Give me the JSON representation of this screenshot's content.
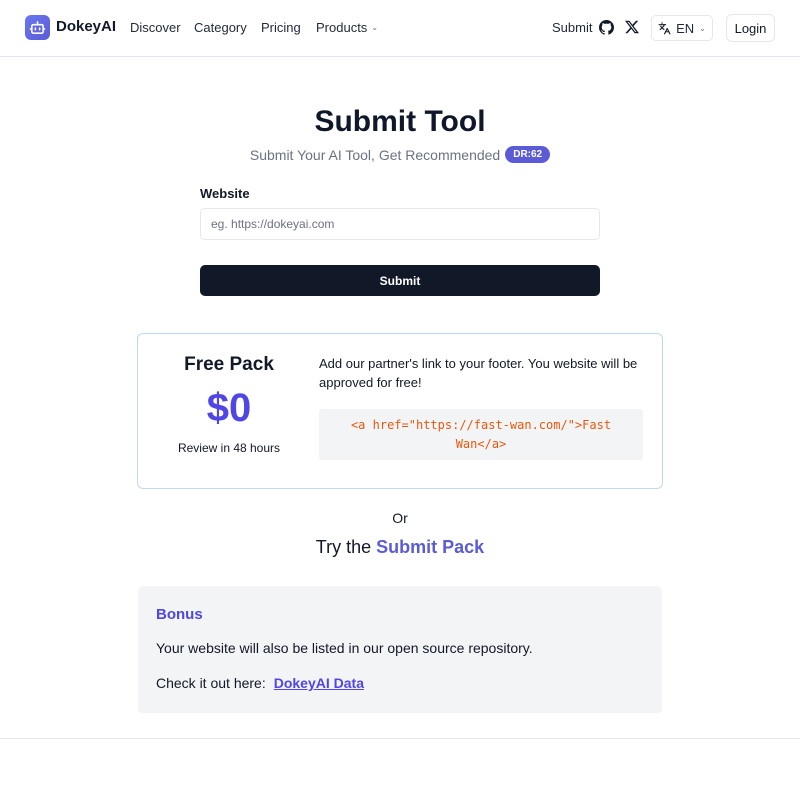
{
  "header": {
    "brand": "DokeyAI",
    "nav": {
      "discover": "Discover",
      "category": "Category",
      "pricing": "Pricing",
      "products": "Products"
    },
    "submit_label": "Submit",
    "language": "EN",
    "login_label": "Login",
    "icons": [
      "robot-logo-icon",
      "github-icon",
      "x-twitter-icon",
      "translate-icon",
      "chevron-down-icon"
    ]
  },
  "main": {
    "title": "Submit Tool",
    "subtitle": "Submit Your AI Tool, Get Recommended",
    "dr_badge": "DR:62",
    "form": {
      "website_label": "Website",
      "website_placeholder": "eg. https://dokeyai.com",
      "website_value": "",
      "submit_label": "Submit"
    },
    "free_pack": {
      "name": "Free Pack",
      "price": "$0",
      "review": "Review in 48 hours",
      "description": "Add our partner's link to your footer. You website will be approved for free!",
      "code_snippet": "<a href=\"https://fast-wan.com/\">Fast Wan</a>"
    },
    "or_text": "Or",
    "try_prefix": "Try the",
    "try_link": "Submit Pack",
    "bonus": {
      "title": "Bonus",
      "text": "Your website will also be listed in our open source repository.",
      "check_prefix": "Check it out here:",
      "link": "DokeyAI Data"
    }
  },
  "colors": {
    "accent": "#5b5bd6",
    "accent_dark": "#4f46e5",
    "button_dark": "#111827",
    "code_orange": "#ea580c"
  }
}
